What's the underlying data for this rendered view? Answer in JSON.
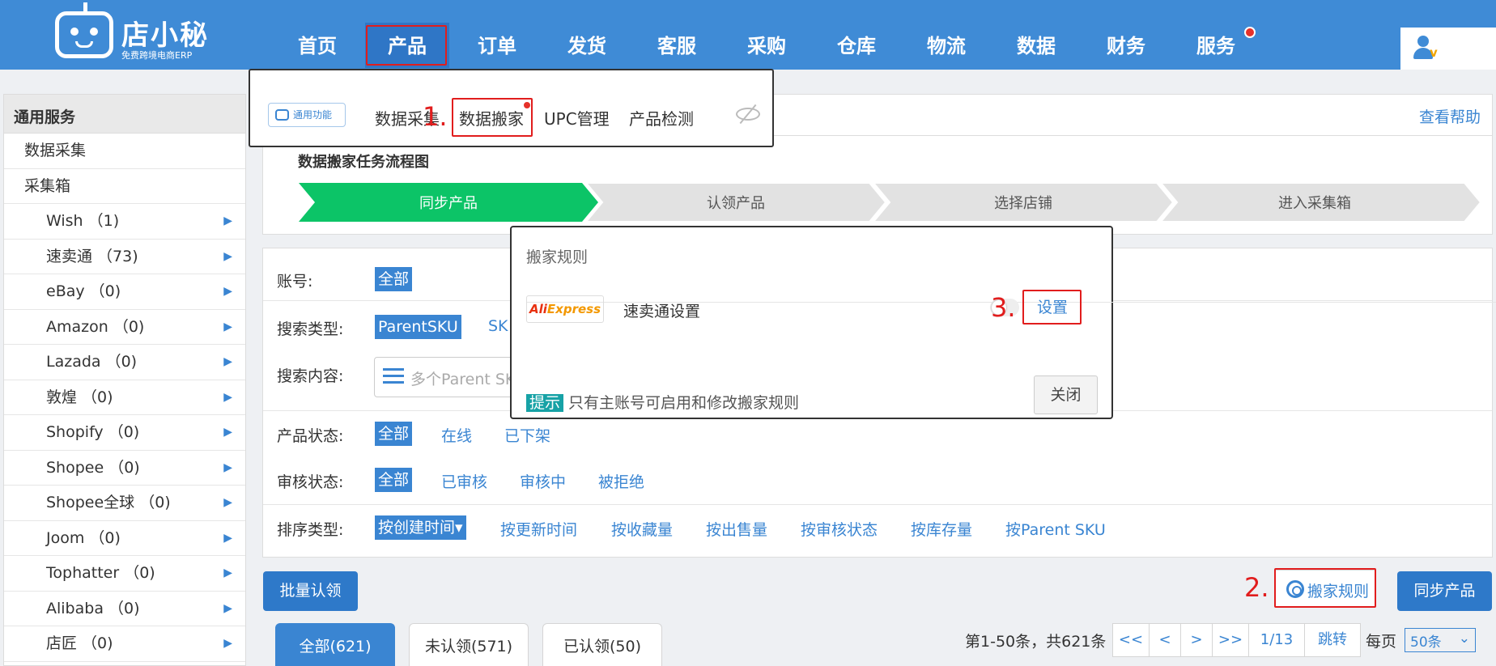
{
  "brand": {
    "name": "店小秘",
    "subtitle": "免费跨境电商ERP"
  },
  "nav": [
    "首页",
    "产品",
    "订单",
    "发货",
    "客服",
    "采购",
    "仓库",
    "物流",
    "数据",
    "财务",
    "服务"
  ],
  "annotations": {
    "n1": "1.",
    "n2": "2.",
    "n3": "3."
  },
  "gf_panel": {
    "badge": "通用功能",
    "items": [
      "数据采集",
      "数据搬家",
      "UPC管理",
      "产品检测"
    ]
  },
  "help": {
    "link": "查看帮助"
  },
  "sidebar": {
    "title": "通用服务",
    "top_items": [
      "数据采集",
      "采集箱"
    ],
    "platforms": [
      "Wish （1)",
      "速卖通 （73)",
      "eBay （0)",
      "Amazon （0)",
      "Lazada （0)",
      "敦煌 （0)",
      "Shopify （0)",
      "Shopee （0)",
      "Shopee全球 （0)",
      "Joom （0)",
      "Tophatter （0)",
      "Alibaba （0)",
      "店匠 （0)"
    ]
  },
  "flow": {
    "title": "数据搬家任务流程图",
    "steps": [
      "同步产品",
      "认领产品",
      "选择店铺",
      "进入采集箱"
    ]
  },
  "filters": {
    "account_label": "账号:",
    "account_all": "全部",
    "search_type_label": "搜索类型:",
    "search_type_on": "ParentSKU",
    "search_type_other": "SK",
    "search_content_label": "搜索内容:",
    "search_placeholder": "多个Parent SKU",
    "status_label": "产品状态:",
    "status_all": "全部",
    "status_online": "在线",
    "status_offline": "已下架",
    "review_label": "审核状态:",
    "review_all": "全部",
    "review_done": "已审核",
    "review_doing": "审核中",
    "review_rejected": "被拒绝",
    "sort_label": "排序类型:",
    "sort_on": "按创建时间▾",
    "sort_options": [
      "按更新时间",
      "按收藏量",
      "按出售量",
      "按审核状态",
      "按库存量",
      "按Parent SKU"
    ]
  },
  "actions": {
    "batch_claim": "批量认领",
    "move_rule": "搬家规则",
    "sync_product": "同步产品"
  },
  "tabs": [
    "全部(621)",
    "未认领(571)",
    "已认领(50)"
  ],
  "pager": {
    "info": "第1-50条，共621条",
    "first": "<<",
    "prev": "<",
    "next": ">",
    "last": ">>",
    "page": "1/13",
    "jump": "跳转",
    "per_page_label": "每页",
    "per_page": "50条"
  },
  "modal": {
    "title": "搬家规则",
    "logo_red": "Ali",
    "logo_orange": "Express",
    "platform": "速卖通设置",
    "set_button": "设置",
    "tip_badge": "提示",
    "tip_text": "只有主账号可启用和修改搬家规则",
    "close": "关闭"
  },
  "colors": {
    "primary": "#3f8bd6",
    "link": "#3a85d2",
    "step_active": "#0cc467",
    "annotation": "#e11d1d"
  }
}
